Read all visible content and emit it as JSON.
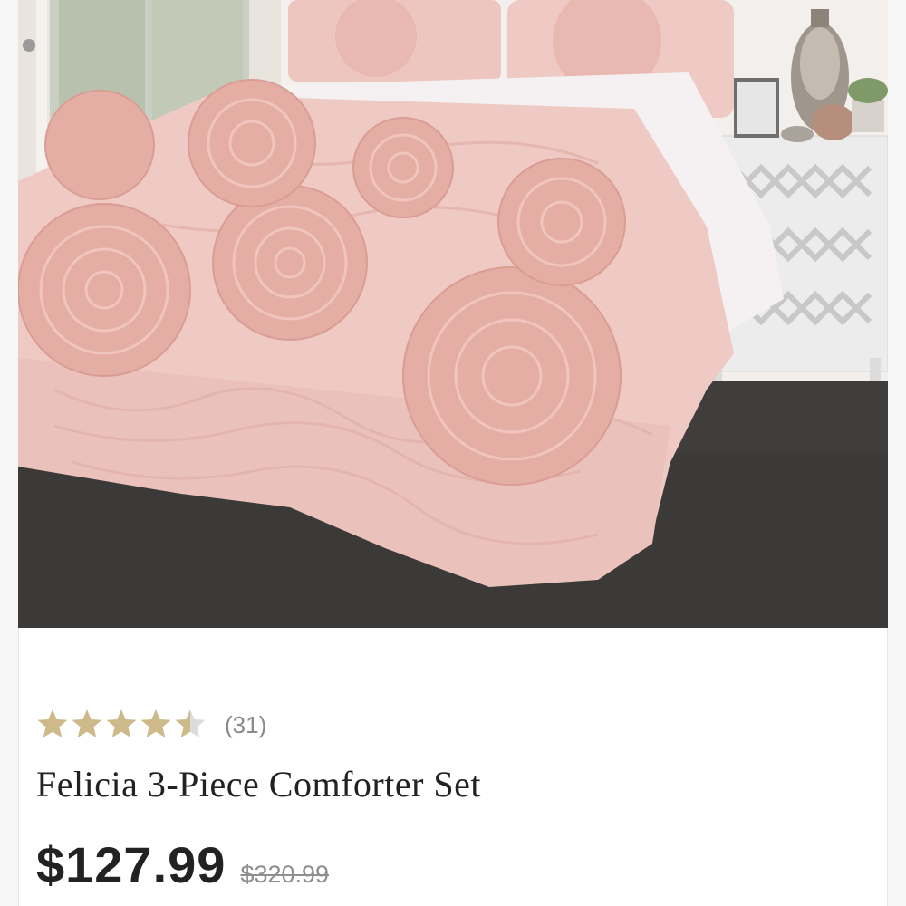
{
  "product": {
    "image_alt": "Felicia 3-Piece Comforter Set in blush pink",
    "rating": {
      "value": 4.5,
      "max": 5,
      "count_label": "(31)"
    },
    "title": "Felicia 3-Piece Comforter Set",
    "price": "$127.99",
    "original_price": "$320.99"
  },
  "colors": {
    "star_filled": "#cdb98a",
    "star_empty": "#dcdcdc",
    "comforter": "#efc9c3",
    "floor": "#403e3c"
  },
  "icons": {
    "rating_star": "star-icon"
  }
}
